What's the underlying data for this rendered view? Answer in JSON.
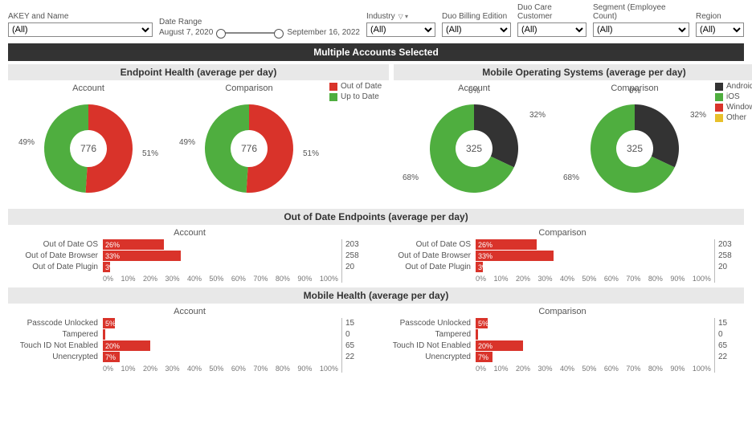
{
  "filters": {
    "akey": {
      "label": "AKEY and Name",
      "value": "(All)"
    },
    "date": {
      "label": "Date Range",
      "start": "August 7, 2020",
      "end": "September 16, 2022"
    },
    "industry": {
      "label": "Industry",
      "value": "(All)"
    },
    "billing": {
      "label": "Duo Billing Edition",
      "value": "(All)"
    },
    "care": {
      "label": "Duo Care Customer",
      "value": "(All)"
    },
    "segment": {
      "label": "Segment (Employee Count)",
      "value": "(All)"
    },
    "region": {
      "label": "Region",
      "value": "(All)"
    }
  },
  "banner": "Multiple Accounts Selected",
  "sections": {
    "endpoint": "Endpoint Health (average per day)",
    "mobile_os": "Mobile Operating Systems (average per day)",
    "ood": "Out of Date Endpoints (average per day)",
    "mobile_health": "Mobile Health (average per day)"
  },
  "subheads": {
    "account": "Account",
    "comparison": "Comparison"
  },
  "legends": {
    "endpoint": [
      {
        "label": "Out of Date",
        "color": "#d9332a"
      },
      {
        "label": "Up to Date",
        "color": "#4fae3f"
      }
    ],
    "mobile": [
      {
        "label": "Android",
        "color": "#333333"
      },
      {
        "label": "iOS",
        "color": "#4fae3f"
      },
      {
        "label": "Windows",
        "color": "#d9332a"
      },
      {
        "label": "Other",
        "color": "#e8c02a"
      }
    ]
  },
  "chart_data": {
    "endpoint_health": {
      "type": "pie",
      "center": "776",
      "account": {
        "series": [
          {
            "name": "Out of Date",
            "value": 51,
            "color": "#d9332a"
          },
          {
            "name": "Up to Date",
            "value": 49,
            "color": "#4fae3f"
          }
        ]
      },
      "comparison": {
        "series": [
          {
            "name": "Out of Date",
            "value": 51,
            "color": "#d9332a"
          },
          {
            "name": "Up to Date",
            "value": 49,
            "color": "#4fae3f"
          }
        ]
      }
    },
    "mobile_os": {
      "type": "pie",
      "center": "325",
      "account": {
        "series": [
          {
            "name": "Android",
            "value": 32,
            "color": "#333333"
          },
          {
            "name": "iOS",
            "value": 68,
            "color": "#4fae3f"
          },
          {
            "name": "Windows",
            "value": 0,
            "color": "#d9332a"
          },
          {
            "name": "Other",
            "value": 0,
            "color": "#e8c02a"
          }
        ],
        "top": "0%"
      },
      "comparison": {
        "series": [
          {
            "name": "Android",
            "value": 32,
            "color": "#333333"
          },
          {
            "name": "iOS",
            "value": 68,
            "color": "#4fae3f"
          },
          {
            "name": "Windows",
            "value": 0,
            "color": "#d9332a"
          },
          {
            "name": "Other",
            "value": 0,
            "color": "#e8c02a"
          }
        ],
        "top": "0%"
      }
    },
    "out_of_date": {
      "type": "bar",
      "xlim": [
        0,
        100
      ],
      "xticks": [
        "0%",
        "10%",
        "20%",
        "30%",
        "40%",
        "50%",
        "60%",
        "70%",
        "80%",
        "90%",
        "100%"
      ],
      "categories": [
        "Out of Date OS",
        "Out of Date Browser",
        "Out of Date Plugin"
      ],
      "account": {
        "pct": [
          26,
          33,
          3
        ],
        "counts": [
          203,
          258,
          20
        ]
      },
      "comparison": {
        "pct": [
          26,
          33,
          3
        ],
        "counts": [
          203,
          258,
          20
        ]
      }
    },
    "mobile_health": {
      "type": "bar",
      "xlim": [
        0,
        100
      ],
      "xticks": [
        "0%",
        "10%",
        "20%",
        "30%",
        "40%",
        "50%",
        "60%",
        "70%",
        "80%",
        "90%",
        "100%"
      ],
      "categories": [
        "Passcode Unlocked",
        "Tampered",
        "Touch ID Not Enabled",
        "Unencrypted"
      ],
      "account": {
        "pct": [
          5,
          0,
          20,
          7
        ],
        "counts": [
          15,
          0,
          65,
          22
        ]
      },
      "comparison": {
        "pct": [
          5,
          0,
          20,
          7
        ],
        "counts": [
          15,
          0,
          65,
          22
        ]
      }
    }
  }
}
